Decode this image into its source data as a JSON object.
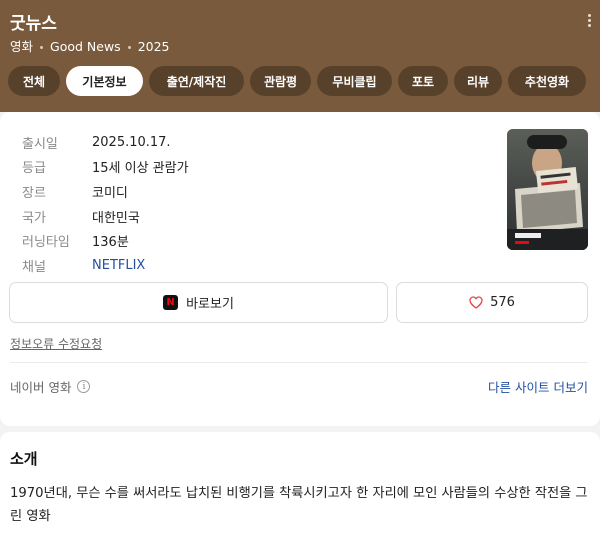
{
  "header": {
    "title": "굿뉴스",
    "meta": [
      "영화",
      "Good News",
      "2025"
    ]
  },
  "tabs": [
    {
      "label": "전체",
      "active": false
    },
    {
      "label": "기본정보",
      "active": true
    },
    {
      "label": "출연/제작진",
      "active": false
    },
    {
      "label": "관람평",
      "active": false
    },
    {
      "label": "무비클립",
      "active": false
    },
    {
      "label": "포토",
      "active": false
    },
    {
      "label": "리뷰",
      "active": false
    },
    {
      "label": "추천영화",
      "active": false
    }
  ],
  "info": [
    {
      "key": "출시일",
      "value": "2025.10.17."
    },
    {
      "key": "등급",
      "value": "15세 이상 관람가"
    },
    {
      "key": "장르",
      "value": "코미디"
    },
    {
      "key": "국가",
      "value": "대한민국"
    },
    {
      "key": "러닝타임",
      "value": "136분"
    },
    {
      "key": "채널",
      "value": "NETFLIX"
    }
  ],
  "actions": {
    "watch_label": "바로보기",
    "netflix_icon_letter": "N",
    "like_count": "576"
  },
  "report_link": "정보오류 수정요청",
  "source": {
    "label": "네이버 영화",
    "more_link": "다른 사이트 더보기"
  },
  "intro": {
    "title": "소개",
    "text": "1970년대, 무슨 수를 써서라도 납치된 비행기를 착륙시키고자 한 자리에 모인 사람들의 수상한 작전을 그린 영화"
  },
  "colors": {
    "header_bg": "#7a5a3c",
    "link": "#2450a0",
    "netflix_red": "#e50914"
  }
}
